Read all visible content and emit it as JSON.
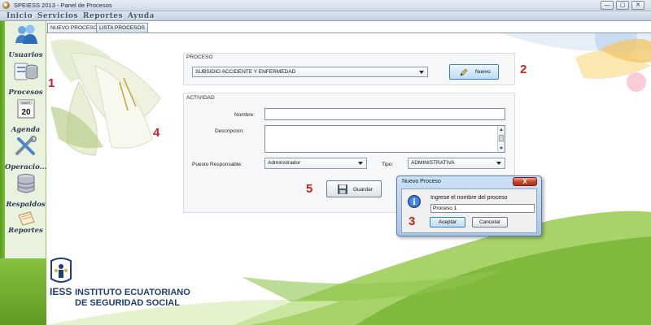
{
  "window": {
    "title": "SPEIESS 2013 - Panel de Procesos",
    "controls": [
      "—",
      "▢",
      "✕"
    ]
  },
  "menubar": {
    "items": [
      "Inicio",
      "Servicios",
      "Reportes",
      "Ayuda"
    ]
  },
  "sidebar": {
    "items": [
      {
        "label": "Usuarios",
        "icon": "users-icon"
      },
      {
        "label": "Procesos",
        "icon": "processes-icon"
      },
      {
        "label": "Agenda",
        "icon": "calendar-icon"
      },
      {
        "label": "Operacio...",
        "icon": "tools-icon"
      },
      {
        "label": "Respaldos",
        "icon": "database-icon"
      },
      {
        "label": "Reportes",
        "icon": "reports-icon"
      }
    ],
    "calendar_month": "MART",
    "calendar_day": "20"
  },
  "tabs": [
    {
      "label": "NUEVO PROCESO",
      "active": true
    },
    {
      "label": "LISTA PROCESOS",
      "active": false
    }
  ],
  "proceso": {
    "section_label": "PROCESO",
    "selected": "SUBSIDIO ACCIDENTE Y ENFERMEDAD",
    "nuevo_button": "Nuevo"
  },
  "actividad": {
    "section_label": "ACTIVIDAD",
    "nombre_label": "Nombre:",
    "nombre_value": "",
    "descripcion_label": "Descripcion:",
    "descripcion_value": "",
    "puesto_label": "Puesto Responsable:",
    "puesto_value": "Administrador",
    "tipo_label": "Tipo:",
    "tipo_value": "ADMINISTRATIVA",
    "guardar_button": "Guardar"
  },
  "dialog": {
    "title": "Nuevo Proceso",
    "close": "X",
    "prompt": "Ingrese el nombre del proceso",
    "input_value": "Proceso 1",
    "accept_button": "Aceptar",
    "cancel_button": "Cancelar",
    "info_icon_text": "i"
  },
  "annotations": [
    "1",
    "2",
    "3",
    "4",
    "5"
  ],
  "logo": {
    "line1": "INSTITUTO ECUATORIANO",
    "line2": "DE SEGURIDAD SOCIAL",
    "abbr": "IESS"
  },
  "colors": {
    "annotation": "#d02020",
    "sidebar_green": "#6aa82a",
    "logo_blue": "#1f3d7a"
  }
}
